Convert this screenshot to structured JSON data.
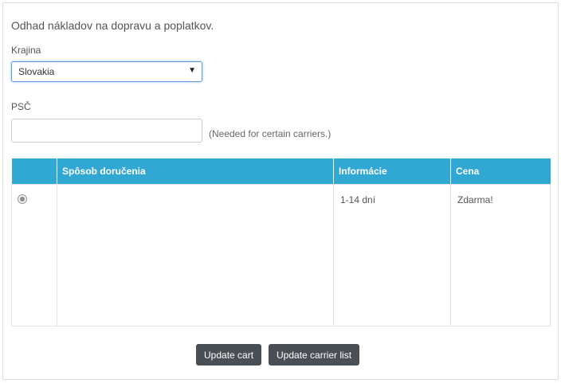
{
  "form": {
    "intro_text": "Odhad nákladov na dopravu a poplatkov.",
    "country_label": "Krajina",
    "country_selected": "Slovakia",
    "zip_label": "PSČ",
    "zip_value": "",
    "zip_hint": "(Needed for certain carriers.)"
  },
  "carriers_table": {
    "headers": [
      "",
      "Spôsob doručenia",
      "Informácie",
      "Cena"
    ],
    "rows": [
      {
        "selected": true,
        "method": "",
        "info": "1-14 dní",
        "price": "Zdarma!"
      }
    ]
  },
  "buttons": {
    "update_cart": "Update cart",
    "update_carrier_list": "Update carrier list"
  },
  "colors": {
    "header_bg": "#31a7d4",
    "button_bg": "#4a4f55",
    "select_focus": "#5b9dd9"
  }
}
